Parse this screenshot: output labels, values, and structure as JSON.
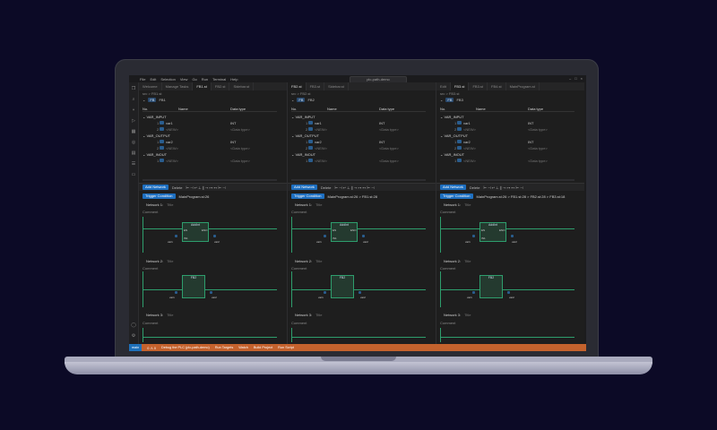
{
  "window": {
    "menu": [
      "File",
      "Edit",
      "Selection",
      "View",
      "Go",
      "Run",
      "Terminal",
      "Help"
    ],
    "search": "plc-path-demo"
  },
  "panes": [
    {
      "tabs": [
        "Welcome",
        "Manage Tasks",
        "FB1.st",
        "FB2.st",
        "Sidebar.st"
      ],
      "active_tab": 2,
      "breadcrumb": "src > FB1.st",
      "fb_label": "FB1",
      "trigger_path": "MainProgram.st:26",
      "variables": {
        "header": {
          "no": "No.",
          "name": "Name",
          "type": "Data type"
        },
        "sections": [
          {
            "label": "VAR_INPUT",
            "rows": [
              {
                "idx": "1",
                "name": "var1",
                "type": "INT"
              },
              {
                "idx": "2",
                "name": "<NEW>",
                "type": "<Data type>"
              }
            ]
          },
          {
            "label": "VAR_OUTPUT",
            "rows": [
              {
                "idx": "1",
                "name": "var2",
                "type": "INT"
              },
              {
                "idx": "2",
                "name": "<NEW>",
                "type": "<Data type>"
              }
            ]
          },
          {
            "label": "VAR_INOUT",
            "rows": [
              {
                "idx": "1",
                "name": "<NEW>",
                "type": "<Data type>"
              }
            ]
          }
        ]
      }
    },
    {
      "tabs": [
        "FB2.st",
        "FB3.st",
        "Sidebar.st"
      ],
      "active_tab": 0,
      "breadcrumb": "src > FB2.st",
      "fb_label": "FB2",
      "trigger_path": "MainProgram.st:26 > FB1.st:28",
      "variables": {
        "header": {
          "no": "No.",
          "name": "Name",
          "type": "Data type"
        },
        "sections": [
          {
            "label": "VAR_INPUT",
            "rows": [
              {
                "idx": "1",
                "name": "var1",
                "type": "INT"
              },
              {
                "idx": "2",
                "name": "<NEW>",
                "type": "<Data type>"
              }
            ]
          },
          {
            "label": "VAR_OUTPUT",
            "rows": [
              {
                "idx": "1",
                "name": "var2",
                "type": "INT"
              },
              {
                "idx": "2",
                "name": "<NEW>",
                "type": "<Data type>"
              }
            ]
          },
          {
            "label": "VAR_INOUT",
            "rows": [
              {
                "idx": "1",
                "name": "<NEW>",
                "type": "<Data type>"
              }
            ]
          }
        ]
      }
    },
    {
      "tabs": [
        "Edit",
        "FB3.st",
        "FB3.st",
        "FB4.st",
        "MainProgram.st"
      ],
      "active_tab": 1,
      "breadcrumb": "src > FB3.st",
      "fb_label": "FB3",
      "trigger_path": "MainProgram.st:26 > FB1.st:28 > FB2.st:28 > FB3.st:18",
      "variables": {
        "header": {
          "no": "No.",
          "name": "Name",
          "type": "Data type"
        },
        "sections": [
          {
            "label": "VAR_INPUT",
            "rows": [
              {
                "idx": "1",
                "name": "var1",
                "type": "INT"
              },
              {
                "idx": "2",
                "name": "<NEW>",
                "type": "<Data type>"
              }
            ]
          },
          {
            "label": "VAR_OUTPUT",
            "rows": [
              {
                "idx": "1",
                "name": "var2",
                "type": "INT"
              },
              {
                "idx": "2",
                "name": "<NEW>",
                "type": "<Data type>"
              }
            ]
          },
          {
            "label": "VAR_INOUT",
            "rows": [
              {
                "idx": "1",
                "name": "<NEW>",
                "type": "<Data type>"
              }
            ]
          }
        ]
      }
    }
  ],
  "toolbar": {
    "add_network": "Add Network",
    "delete": "Delete",
    "trigger": "Trigger Condition"
  },
  "networks": {
    "n1": "Network 1:",
    "n2": "Network 2:",
    "n3": "Network 3:",
    "title": "Title",
    "comment": "Comment",
    "block1": "AddInt",
    "block2": "FB2",
    "en": "EN",
    "eno": "ENO",
    "in1": "IN1",
    "in2": "IN2",
    "out": "OUT",
    "var1": "var1",
    "var2": "var2"
  },
  "status": {
    "remote": "main",
    "items": [
      "0 ⚠ 0",
      "Debug the PLC (plc-path-demo)",
      "Run Targets",
      "Watch",
      "Build Project",
      "Run Script"
    ]
  }
}
